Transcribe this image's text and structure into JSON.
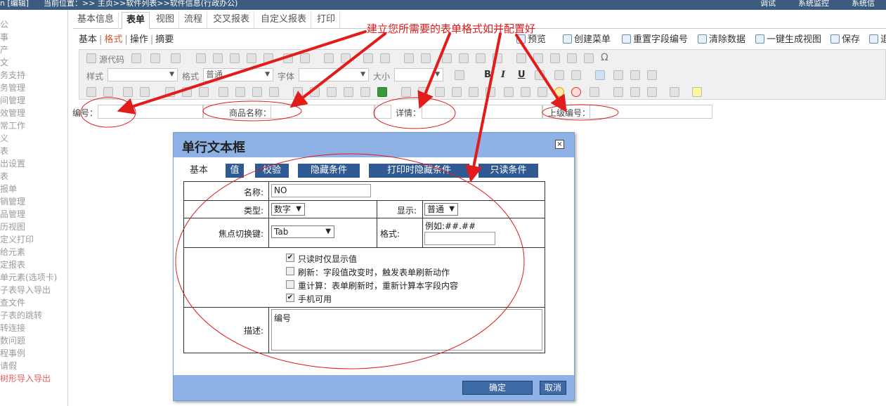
{
  "topbar": {
    "left": "n [编辑]",
    "path": "当前位置：>> 主页>>软件列表>>软件信息(行政办公)",
    "right_items": [
      "调试",
      "系统监控",
      "系统信"
    ]
  },
  "sidebar": {
    "items": [
      "公",
      "事",
      "产",
      "文",
      "务支持",
      "务管理",
      "间管理",
      "效管理",
      "常工作",
      "义",
      "表",
      "出设置",
      "表",
      "报单",
      "销管理",
      "品管理",
      "历视图",
      "定义打印",
      "给元素",
      "定报表",
      "单元素(选项卡)",
      "子表导入导出",
      "查文件",
      "子表的跳转",
      "转连接",
      "数问题",
      "程事例",
      "请假",
      "树形导入导出"
    ]
  },
  "tabs": [
    "基本信息",
    "表单",
    "视图",
    "流程",
    "交叉报表",
    "自定义报表",
    "打印"
  ],
  "subtabs": {
    "items": [
      "基本",
      "格式",
      "操作",
      "摘要"
    ],
    "separator": "|"
  },
  "right_toolbar": [
    "预览",
    "创建菜单",
    "重置字段编号",
    "清除数据",
    "一键生成视图",
    "保存",
    "退"
  ],
  "editor_toolbar": {
    "source": "源代码",
    "style_label": "样式",
    "format_label": "格式",
    "format_value": "普通",
    "font_label": "字体",
    "size_label": "大小",
    "bold": "B",
    "italic": "I",
    "underline": "U",
    "omega": "Ω"
  },
  "form_row": {
    "fields": [
      {
        "label": "编号："
      },
      {
        "label": "商品名称："
      },
      {
        "label": "详情："
      },
      {
        "label": "上级编号："
      }
    ]
  },
  "annotation": {
    "text": "建立您所需要的表单格式如并配置好",
    "color": "#e21b1b"
  },
  "dialog": {
    "title": "单行文本框",
    "close": "×",
    "tabs": [
      "基本",
      "值",
      "校验",
      "隐藏条件",
      "打印时隐藏条件",
      "只读条件"
    ],
    "name_label": "名称:",
    "name_value": "NO",
    "type_label": "类型:",
    "type_value": "数字",
    "display_label": "显示:",
    "display_value": "普通",
    "focus_label": "焦点切换键:",
    "focus_value": "Tab",
    "format_label": "格式:",
    "format_hint": "例如:##.##",
    "checkboxes": [
      {
        "label": "只读时仅显示值",
        "checked": true
      },
      {
        "label": "刷新：字段值改变时，触发表单刷新动作",
        "checked": false
      },
      {
        "label": "重计算：表单刷新时，重新计算本字段内容",
        "checked": false
      },
      {
        "label": "手机可用",
        "checked": true
      }
    ],
    "desc_label": "描述:",
    "desc_value": "编号",
    "ok": "确定",
    "cancel": "取消"
  }
}
